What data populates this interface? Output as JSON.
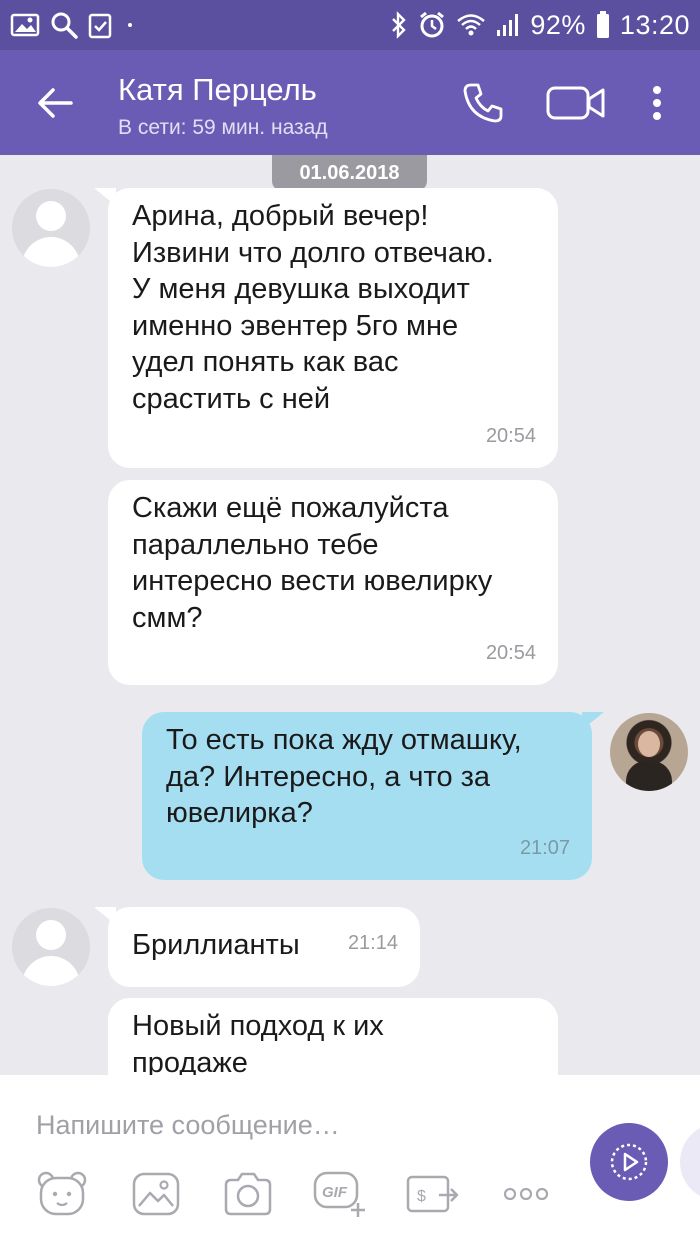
{
  "status_bar": {
    "battery": "92%",
    "time": "13:20",
    "icons": [
      "gallery-icon",
      "search-icon",
      "clipboard-check-icon",
      "bluetooth-icon",
      "alarm-icon",
      "wifi-icon",
      "signal-icon",
      "battery-icon"
    ]
  },
  "header": {
    "contact_name": "Катя Перцель",
    "status": "В сети: 59 мин. назад",
    "icons": [
      "back-arrow-icon",
      "phone-icon",
      "video-camera-icon",
      "more-vert-icon"
    ]
  },
  "chat": {
    "date": "01.06.2018",
    "messages": [
      {
        "direction": "in",
        "lines": [
          "Арина, добрый вечер!",
          "Извини что долго отвечаю.",
          "У меня девушка выходит",
          "именно эвентер 5го мне",
          "удел понять как вас",
          "срастить с ней"
        ],
        "time": "20:54"
      },
      {
        "direction": "in",
        "lines": [
          "Скажи ещё пожалуйста",
          "параллельно тебе",
          "интересно вести ювелирку",
          "смм?"
        ],
        "time": "20:54"
      },
      {
        "direction": "out",
        "lines": [
          "То есть пока жду отмашку,",
          "да? Интересно, а что за",
          "ювелирка?"
        ],
        "time": "21:07"
      },
      {
        "direction": "in",
        "lines": [
          "Бриллианты"
        ],
        "time": "21:14"
      },
      {
        "direction": "in",
        "lines": [
          "Новый подход к их",
          "продаже"
        ],
        "time": ""
      }
    ]
  },
  "composer": {
    "placeholder": "Напишите сообщение…",
    "tools": [
      "sticker-bear-icon",
      "gallery-icon",
      "camera-icon",
      "gif-icon",
      "wallet-send-icon",
      "more-horiz-icon"
    ],
    "send_icon": "send-play-icon"
  },
  "colors": {
    "status_bar": "#5b4fa0",
    "header": "#6a5cb4",
    "chat_bg": "#e9e9ee",
    "incoming_bubble": "#ffffff",
    "outgoing_bubble": "#a6def1",
    "accent": "#6a5cb4"
  }
}
